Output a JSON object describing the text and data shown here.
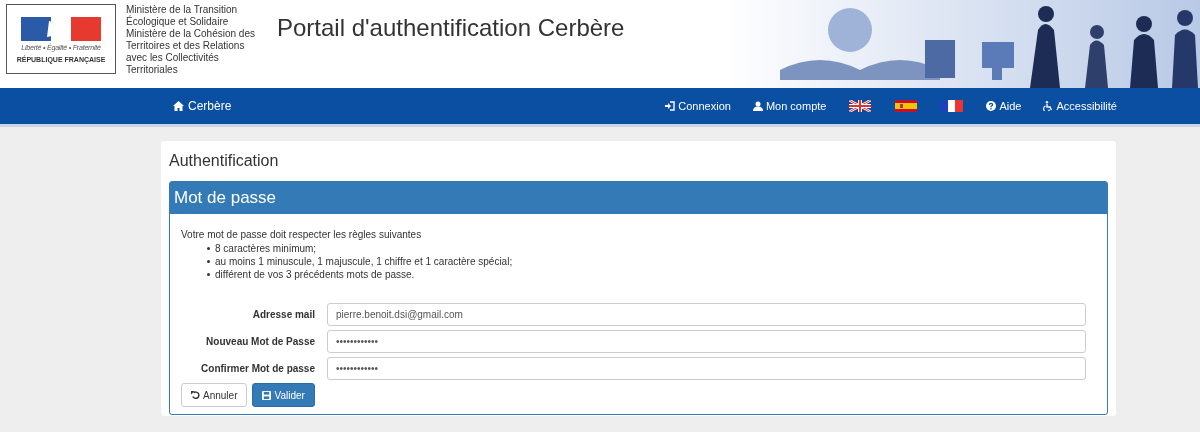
{
  "logo": {
    "motto": "Liberté • Égalité • Fraternité",
    "republic": "RÉPUBLIQUE FRANÇAISE"
  },
  "ministry": [
    "Ministère de la Transition",
    "Écologique et Solidaire",
    "Ministère de la Cohésion des",
    "Territoires et des Relations",
    "avec les Collectivités",
    "Territoriales"
  ],
  "site_title": "Portail d'authentification Cerbère",
  "nav": {
    "brand": "Cerbère",
    "items": [
      {
        "kind": "login",
        "label": "Connexion"
      },
      {
        "kind": "account",
        "label": "Mon compte"
      },
      {
        "kind": "flag-uk"
      },
      {
        "kind": "flag-es"
      },
      {
        "kind": "flag-fr"
      },
      {
        "kind": "help",
        "label": "Aide"
      },
      {
        "kind": "accessibility",
        "label": "Accessibilité"
      }
    ]
  },
  "page_title": "Authentification",
  "panel": {
    "title": "Mot de passe",
    "rules_intro": "Votre mot de passe doit respecter les règles suivantes",
    "rules": [
      "8 caractères minimum;",
      "au moins 1 minuscule, 1 majuscule, 1 chiffre et 1 caractère spécial;",
      "différent de vos 3 précédents mots de passe."
    ],
    "fields": [
      {
        "label": "Adresse mail",
        "value": "pierre.benoit.dsi@gmail.com"
      },
      {
        "label": "Nouveau Mot de Passe",
        "value": "••••••••••••"
      },
      {
        "label": "Confirmer Mot de passe",
        "value": "••••••••••••"
      }
    ],
    "buttons": [
      {
        "kind": "cancel",
        "label": "Annuler"
      },
      {
        "kind": "submit",
        "label": "Valider"
      }
    ]
  }
}
